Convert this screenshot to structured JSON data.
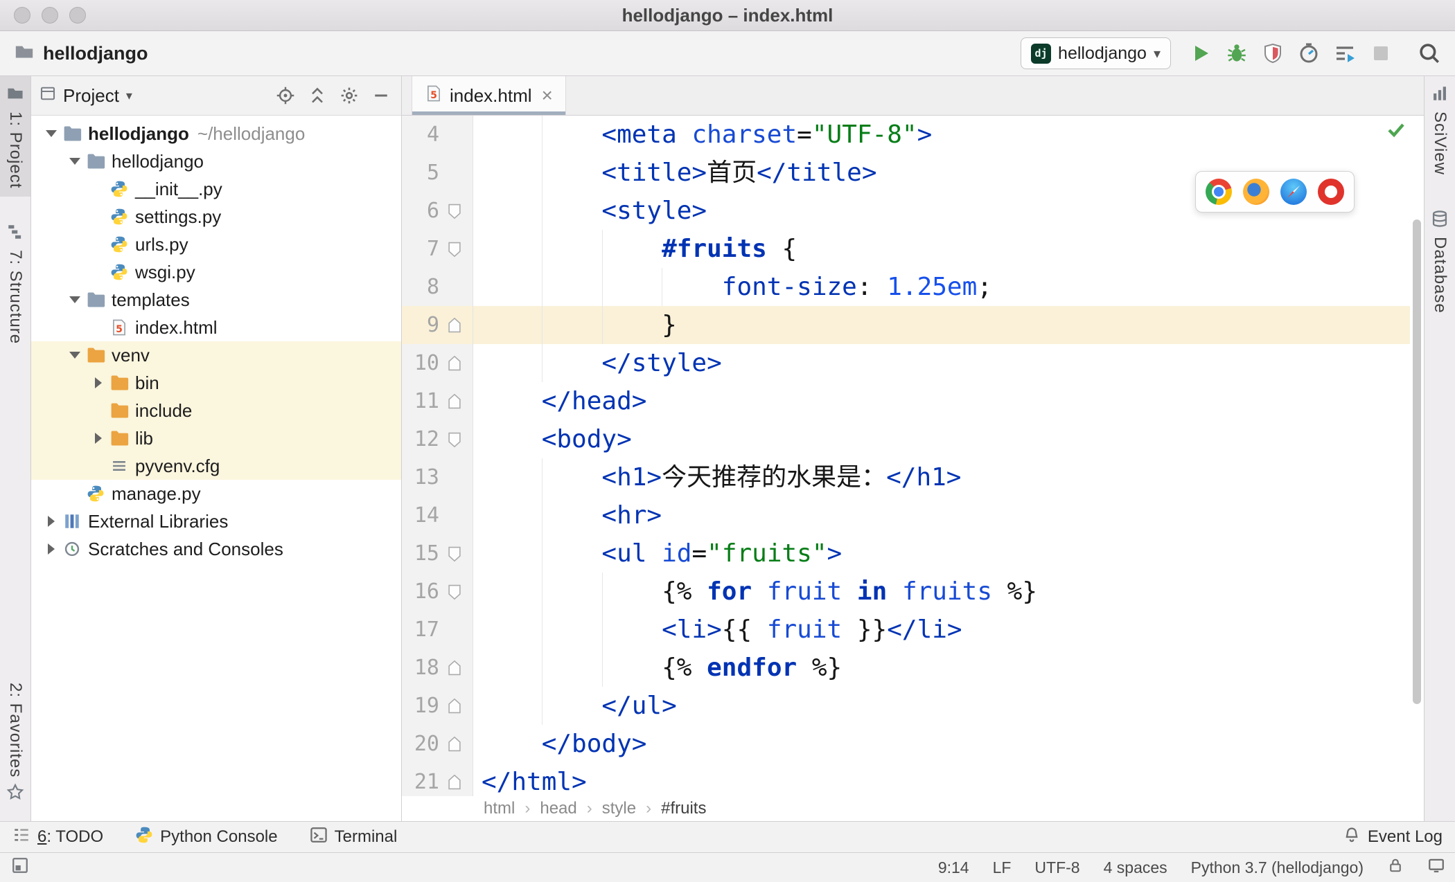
{
  "window": {
    "title": "hellodjango – index.html"
  },
  "toolbar": {
    "project_name": "hellodjango",
    "run_config": {
      "icon_text": "dj",
      "label": "hellodjango"
    },
    "icons": [
      "run-icon",
      "debug-icon",
      "coverage-icon",
      "profiler-icon",
      "run-with-profiler-icon",
      "stop-icon",
      "search-icon"
    ]
  },
  "left_strip": {
    "project": "1: Project",
    "structure": "7: Structure",
    "favorites": "2: Favorites"
  },
  "right_strip": {
    "sciview": "SciView",
    "database": "Database"
  },
  "project_panel": {
    "title": "Project",
    "header_icons": [
      "locate-icon",
      "collapse-all-icon",
      "gear-icon",
      "hide-icon"
    ],
    "tree": [
      {
        "label": "hellodjango",
        "hint": "~/hellodjango",
        "icon": "folder",
        "level": 0,
        "chevron": "open",
        "bold": true
      },
      {
        "label": "hellodjango",
        "icon": "folder",
        "level": 1,
        "chevron": "open"
      },
      {
        "label": "__init__.py",
        "icon": "python",
        "level": 2
      },
      {
        "label": "settings.py",
        "icon": "python",
        "level": 2
      },
      {
        "label": "urls.py",
        "icon": "python",
        "level": 2
      },
      {
        "label": "wsgi.py",
        "icon": "python",
        "level": 2
      },
      {
        "label": "templates",
        "icon": "folder",
        "level": 1,
        "chevron": "open"
      },
      {
        "label": "index.html",
        "icon": "html",
        "level": 2
      },
      {
        "label": "venv",
        "icon": "folder-ex",
        "level": 1,
        "chevron": "open",
        "yellow": true
      },
      {
        "label": "bin",
        "icon": "folder-ex",
        "level": 2,
        "chevron": "closed",
        "yellow": true
      },
      {
        "label": "include",
        "icon": "folder-ex",
        "level": 2,
        "yellow": true
      },
      {
        "label": "lib",
        "icon": "folder-ex",
        "level": 2,
        "chevron": "closed",
        "yellow": true
      },
      {
        "label": "pyvenv.cfg",
        "icon": "textfile",
        "level": 2,
        "yellow": true
      },
      {
        "label": "manage.py",
        "icon": "python",
        "level": 1
      },
      {
        "label": "External Libraries",
        "icon": "libs",
        "level": 0,
        "chevron": "closed"
      },
      {
        "label": "Scratches and Consoles",
        "icon": "scratch",
        "level": 0,
        "chevron": "closed"
      }
    ]
  },
  "editor": {
    "tab": "index.html",
    "browser_icons": [
      "chrome-icon",
      "firefox-icon",
      "safari-icon",
      "opera-icon"
    ],
    "inspection_status": "ok",
    "breadcrumbs": [
      "html",
      "head",
      "style",
      "#fruits"
    ],
    "lines": [
      {
        "num": 4,
        "indent": 8,
        "segs": [
          [
            "tg",
            "<meta "
          ],
          [
            "at",
            "charset"
          ],
          [
            "tx",
            "="
          ],
          [
            "st",
            "\"UTF-8\""
          ],
          [
            "tg",
            ">"
          ]
        ]
      },
      {
        "num": 5,
        "indent": 8,
        "segs": [
          [
            "tg",
            "<title>"
          ],
          [
            "tx",
            "首页"
          ],
          [
            "tg",
            "</title>"
          ]
        ]
      },
      {
        "num": 6,
        "indent": 8,
        "fold": "down",
        "segs": [
          [
            "tg",
            "<style>"
          ]
        ]
      },
      {
        "num": 7,
        "indent": 12,
        "fold": "down",
        "segs": [
          [
            "cs",
            "#fruits"
          ],
          [
            "tx",
            " {"
          ]
        ]
      },
      {
        "num": 8,
        "indent": 16,
        "segs": [
          [
            "pr",
            "font-size"
          ],
          [
            "tx",
            ": "
          ],
          [
            "nm",
            "1.25em"
          ],
          [
            "tx",
            ";"
          ]
        ]
      },
      {
        "num": 9,
        "indent": 12,
        "fold": "up",
        "hl": true,
        "segs": [
          [
            "tx",
            "}"
          ]
        ]
      },
      {
        "num": 10,
        "indent": 8,
        "fold": "up",
        "segs": [
          [
            "tg",
            "</style>"
          ]
        ]
      },
      {
        "num": 11,
        "indent": 4,
        "fold": "up",
        "segs": [
          [
            "tg",
            "</head>"
          ]
        ]
      },
      {
        "num": 12,
        "indent": 4,
        "fold": "down",
        "segs": [
          [
            "tg",
            "<body>"
          ]
        ]
      },
      {
        "num": 13,
        "indent": 8,
        "segs": [
          [
            "tg",
            "<h1>"
          ],
          [
            "tx",
            "今天推荐的水果是："
          ],
          [
            "tg",
            "</h1>"
          ]
        ]
      },
      {
        "num": 14,
        "indent": 8,
        "segs": [
          [
            "tg",
            "<hr>"
          ]
        ]
      },
      {
        "num": 15,
        "indent": 8,
        "fold": "down",
        "segs": [
          [
            "tg",
            "<ul "
          ],
          [
            "at",
            "id"
          ],
          [
            "tx",
            "="
          ],
          [
            "st",
            "\"fruits\""
          ],
          [
            "tg",
            ">"
          ]
        ]
      },
      {
        "num": 16,
        "indent": 12,
        "fold": "down",
        "segs": [
          [
            "tx",
            "{% "
          ],
          [
            "kw",
            "for"
          ],
          [
            "tx",
            " "
          ],
          [
            "vr",
            "fruit"
          ],
          [
            "tx",
            " "
          ],
          [
            "kw",
            "in"
          ],
          [
            "tx",
            " "
          ],
          [
            "vr",
            "fruits"
          ],
          [
            "tx",
            " %}"
          ]
        ]
      },
      {
        "num": 17,
        "indent": 12,
        "segs": [
          [
            "tg",
            "<li>"
          ],
          [
            "tx",
            "{{ "
          ],
          [
            "vr",
            "fruit"
          ],
          [
            "tx",
            " }}"
          ],
          [
            "tg",
            "</li>"
          ]
        ]
      },
      {
        "num": 18,
        "indent": 12,
        "fold": "up",
        "segs": [
          [
            "tx",
            "{% "
          ],
          [
            "kw",
            "endfor"
          ],
          [
            "tx",
            " %}"
          ]
        ]
      },
      {
        "num": 19,
        "indent": 8,
        "fold": "up",
        "segs": [
          [
            "tg",
            "</ul>"
          ]
        ]
      },
      {
        "num": 20,
        "indent": 4,
        "fold": "up",
        "segs": [
          [
            "tg",
            "</body>"
          ]
        ]
      },
      {
        "num": 21,
        "indent": 0,
        "fold": "up",
        "segs": [
          [
            "tg",
            "</html>"
          ]
        ]
      }
    ]
  },
  "bottom_bar": {
    "todo": {
      "mnemonic": "6",
      "rest": ": TODO"
    },
    "python_console": "Python Console",
    "terminal": "Terminal",
    "event_log": "Event Log"
  },
  "status_bar": {
    "position": "9:14",
    "line_separator": "LF",
    "encoding": "UTF-8",
    "indent": "4 spaces",
    "interpreter": "Python 3.7 (hellodjango)"
  },
  "colors": {
    "tag": "#0033B3",
    "attribute": "#174AD4",
    "string": "#067D17",
    "number": "#1750EB",
    "keyword": "#0033B3",
    "variable": "#174AD4",
    "run_green": "#52A552",
    "folder_blue": "#8FA0B4",
    "folder_orange": "#EBA441",
    "caret_row": "#FAF1D8",
    "library_row": "#FBF6DE",
    "tab_underline": "#A2AEBE"
  }
}
